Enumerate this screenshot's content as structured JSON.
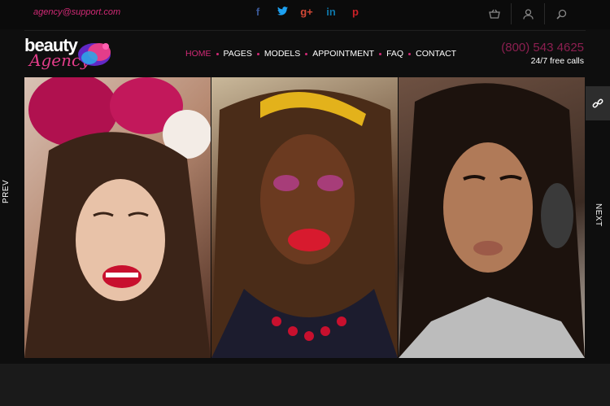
{
  "topbar": {
    "email": "agency@support.com",
    "social": [
      {
        "name": "facebook-icon",
        "glyph": "f",
        "color": "#3b5998"
      },
      {
        "name": "twitter-icon",
        "glyph": "t",
        "color": "#1da1f2"
      },
      {
        "name": "google-plus-icon",
        "glyph": "g+",
        "color": "#d34836"
      },
      {
        "name": "linkedin-icon",
        "glyph": "in",
        "color": "#0e76a8"
      },
      {
        "name": "pinterest-icon",
        "glyph": "p",
        "color": "#cb2027"
      }
    ]
  },
  "logo": {
    "line1": "beauty",
    "line2": "Agency"
  },
  "nav": {
    "items": [
      {
        "label": "Home"
      },
      {
        "label": "Pages"
      },
      {
        "label": "Models"
      },
      {
        "label": "Appointment"
      },
      {
        "label": "FAQ"
      },
      {
        "label": "Contact"
      }
    ]
  },
  "phone": {
    "number": "(800) 543 4625",
    "sub": "24/7 free calls"
  },
  "slider": {
    "prev": "PREV",
    "next": "NEXT"
  },
  "colors": {
    "accent": "#d12a76",
    "background": "#0e0e0e"
  }
}
